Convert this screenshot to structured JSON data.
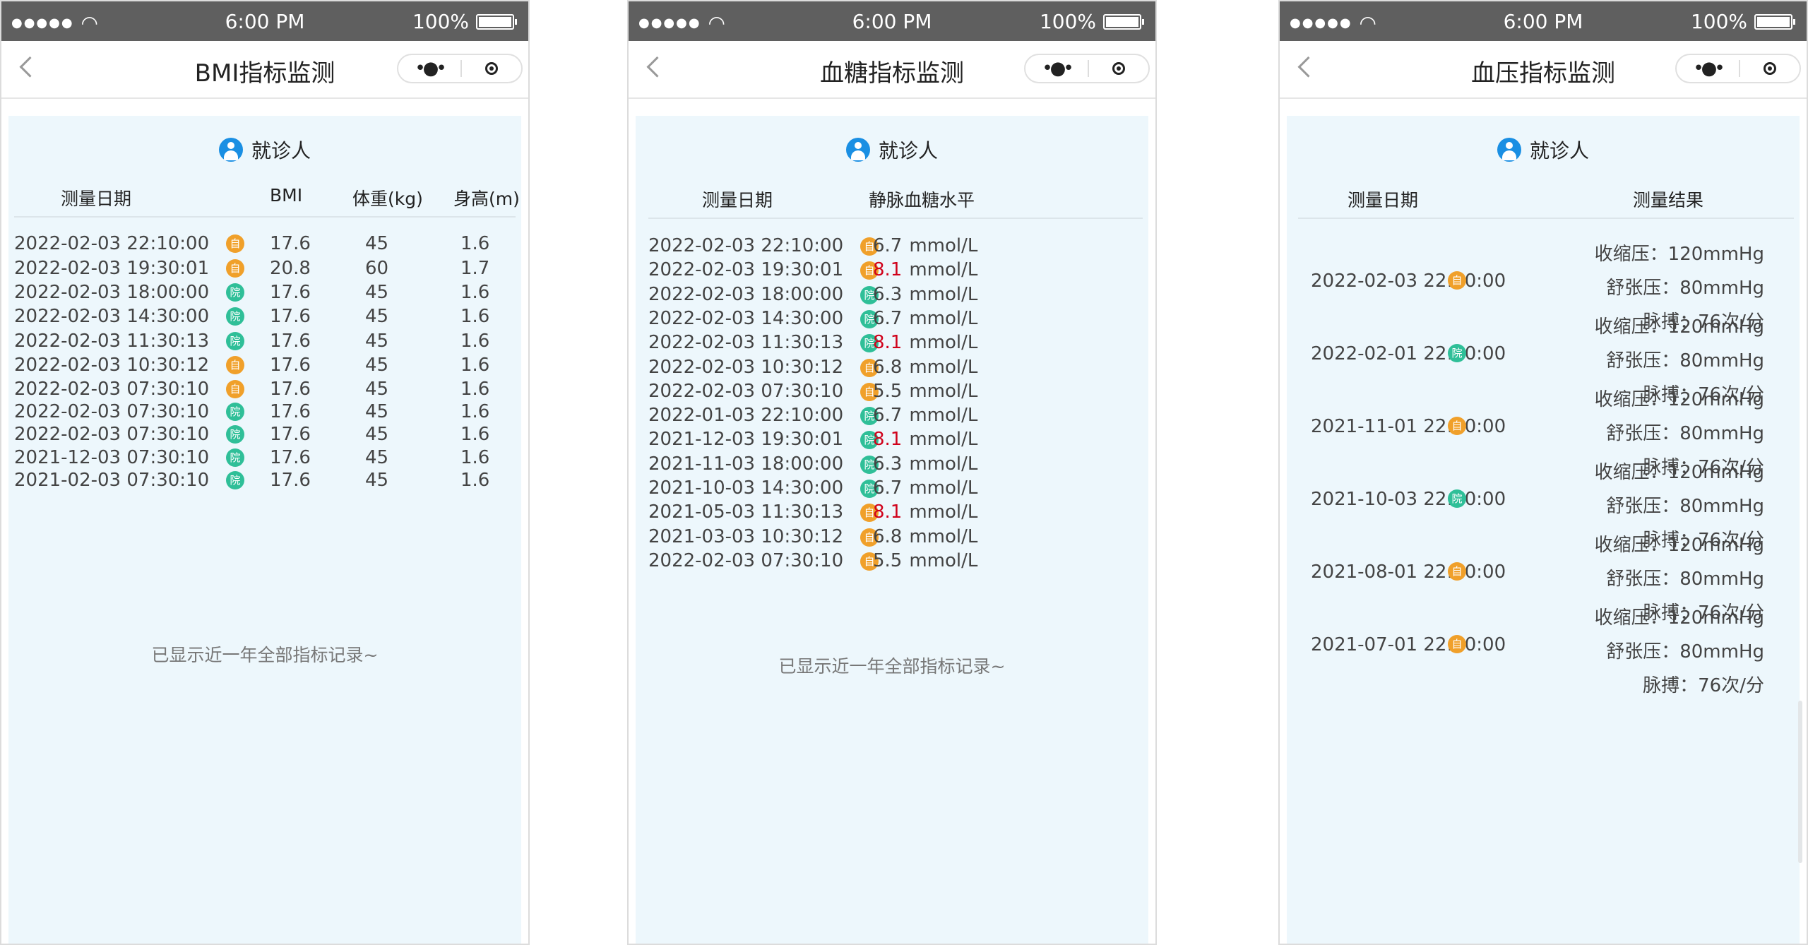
{
  "status": {
    "time": "6:00 PM",
    "battery": "100%",
    "signal": "●●●●●"
  },
  "badges": {
    "self": "自",
    "hosp": "院"
  },
  "patient_label": "就诊人",
  "footer": "已显示近一年全部指标记录~",
  "bmi": {
    "title": "BMI指标监测",
    "headers": {
      "date": "测量日期",
      "bmi": "BMI",
      "weight": "体重(kg)",
      "height": "身高(m)"
    },
    "rows": [
      {
        "date": "2022-02-03   22:10:00",
        "src": "自",
        "bmi": "17.6",
        "weight": "45",
        "height": "1.6"
      },
      {
        "date": "2022-02-03   19:30:01",
        "src": "自",
        "bmi": "20.8",
        "weight": "60",
        "height": "1.7"
      },
      {
        "date": "2022-02-03   18:00:00",
        "src": "院",
        "bmi": "17.6",
        "weight": "45",
        "height": "1.6"
      },
      {
        "date": "2022-02-03   14:30:00",
        "src": "院",
        "bmi": "17.6",
        "weight": "45",
        "height": "1.6"
      },
      {
        "date": "2022-02-03   11:30:13",
        "src": "院",
        "bmi": "17.6",
        "weight": "45",
        "height": "1.6"
      },
      {
        "date": "2022-02-03   10:30:12",
        "src": "自",
        "bmi": "17.6",
        "weight": "45",
        "height": "1.6"
      },
      {
        "date": "2022-02-03   07:30:10",
        "src": "自",
        "bmi": "17.6",
        "weight": "45",
        "height": "1.6"
      },
      {
        "date": "2022-02-03   07:30:10",
        "src": "院",
        "bmi": "17.6",
        "weight": "45",
        "height": "1.6"
      },
      {
        "date": "2022-02-03   07:30:10",
        "src": "院",
        "bmi": "17.6",
        "weight": "45",
        "height": "1.6"
      },
      {
        "date": "2021-12-03   07:30:10",
        "src": "院",
        "bmi": "17.6",
        "weight": "45",
        "height": "1.6"
      },
      {
        "date": "2021-02-03   07:30:10",
        "src": "院",
        "bmi": "17.6",
        "weight": "45",
        "height": "1.6"
      }
    ]
  },
  "glucose": {
    "title": "血糖指标监测",
    "headers": {
      "date": "测量日期",
      "level": "静脉血糖水平"
    },
    "unit": "mmol/L",
    "rows": [
      {
        "date": "2022-02-03   22:10:00",
        "src": "自",
        "value": "6.7",
        "high": false
      },
      {
        "date": "2022-02-03   19:30:01",
        "src": "自",
        "value": "8.1",
        "high": true
      },
      {
        "date": "2022-02-03   18:00:00",
        "src": "院",
        "value": "6.3",
        "high": false
      },
      {
        "date": "2022-02-03   14:30:00",
        "src": "院",
        "value": "6.7",
        "high": false
      },
      {
        "date": "2022-02-03   11:30:13",
        "src": "院",
        "value": "8.1",
        "high": true
      },
      {
        "date": "2022-02-03   10:30:12",
        "src": "自",
        "value": "6.8",
        "high": false
      },
      {
        "date": "2022-02-03   07:30:10",
        "src": "自",
        "value": "5.5",
        "high": false
      },
      {
        "date": "2022-01-03   22:10:00",
        "src": "院",
        "value": "6.7",
        "high": false
      },
      {
        "date": "2021-12-03   19:30:01",
        "src": "院",
        "value": "8.1",
        "high": true
      },
      {
        "date": "2021-11-03   18:00:00",
        "src": "院",
        "value": "6.3",
        "high": false
      },
      {
        "date": "2021-10-03   14:30:00",
        "src": "院",
        "value": "6.7",
        "high": false
      },
      {
        "date": "2021-05-03   11:30:13",
        "src": "自",
        "value": "8.1",
        "high": true
      },
      {
        "date": "2021-03-03   10:30:12",
        "src": "自",
        "value": "6.8",
        "high": false
      },
      {
        "date": "2022-02-03   07:30:10",
        "src": "自",
        "value": "5.5",
        "high": false
      }
    ]
  },
  "pressure": {
    "title": "血压指标监测",
    "headers": {
      "date": "测量日期",
      "result": "测量结果"
    },
    "rows": [
      {
        "date": "2022-02-03   22:10:00",
        "src": "自",
        "systolic": "收缩压：120mmHg",
        "diastolic": "舒张压：80mmHg",
        "pulse": "脉搏：76次/分"
      },
      {
        "date": "2022-02-01   22:10:00",
        "src": "院",
        "systolic": "收缩压：120mmHg",
        "diastolic": "舒张压：80mmHg",
        "pulse": "脉搏：76次/分"
      },
      {
        "date": "2021-11-01   22:10:00",
        "src": "自",
        "systolic": "收缩压：120mmHg",
        "diastolic": "舒张压：80mmHg",
        "pulse": "脉搏：76次/分"
      },
      {
        "date": "2021-10-03   22:10:00",
        "src": "院",
        "systolic": "收缩压：120mmHg",
        "diastolic": "舒张压：80mmHg",
        "pulse": "脉搏：76次/分"
      },
      {
        "date": "2021-08-01   22:10:00",
        "src": "自",
        "systolic": "收缩压：120mmHg",
        "diastolic": "舒张压：80mmHg",
        "pulse": "脉搏：76次/分"
      },
      {
        "date": "2021-07-01   22:10:00",
        "src": "自",
        "systolic": "收缩压：120mmHg",
        "diastolic": "舒张压：80mmHg",
        "pulse": "脉搏：76次/分"
      }
    ]
  }
}
